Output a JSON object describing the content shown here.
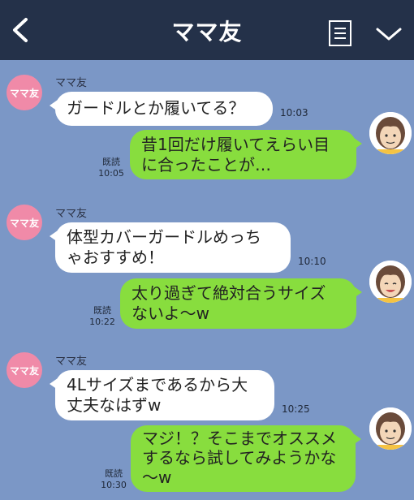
{
  "header": {
    "title": "ママ友"
  },
  "contact": {
    "name": "ママ友",
    "avatar_label": "ママ友",
    "avatar_color": "#f08aa8"
  },
  "colors": {
    "background": "#7b97c6",
    "header": "#243149",
    "outgoing_bubble": "#88dd3e",
    "incoming_bubble": "#ffffff"
  },
  "messages": [
    {
      "from": "other",
      "text": "ガードルとか履いてる？",
      "time": "10:03"
    },
    {
      "from": "me",
      "text": "昔1回だけ履いてえらい目\nに合ったことが…",
      "read": "既読",
      "time": "10:05"
    },
    {
      "from": "other",
      "text": "体型カバーガードルめっち\nゃおすすめ！",
      "time": "10:10"
    },
    {
      "from": "me",
      "text": "太り過ぎて絶対合うサイズ\nないよ〜w",
      "read": "既読",
      "time": "10:22"
    },
    {
      "from": "other",
      "text": "4Lサイズまであるから大\n丈夫なはずw",
      "time": "10:25"
    },
    {
      "from": "me",
      "text": "マジ！？そこまでオススメ\nするなら試してみようかな\n〜w",
      "read": "既読",
      "time": "10:30"
    }
  ]
}
